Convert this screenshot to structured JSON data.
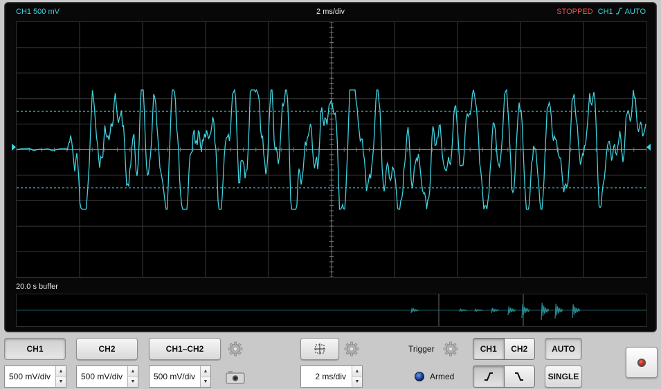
{
  "scope": {
    "ch1_scale_label": "CH1 500 mV",
    "timebase_label": "2 ms/div",
    "trigger_state": "STOPPED",
    "trigger_channel": "CH1",
    "trigger_mode": "AUTO",
    "buffer_label": "20.0 s buffer",
    "trace_color": "#3fd3e0",
    "trigger_upper_level_div": 1.5,
    "trigger_lower_level_div": -1.5,
    "grid_divisions": {
      "horizontal": 10,
      "vertical": 10
    }
  },
  "controls": {
    "ch1_button": "CH1",
    "ch2_button": "CH2",
    "diff_button": "CH1–CH2",
    "ch1_scale_value": "500 mV/div",
    "ch2_scale_value": "500 mV/div",
    "diff_scale_value": "500 mV/div",
    "timebase_value": "2 ms/div",
    "trigger_label": "Trigger",
    "armed_label": "Armed",
    "trigger_source_ch1": "CH1",
    "trigger_source_ch2": "CH2",
    "auto_button": "AUTO",
    "single_button": "SINGLE"
  },
  "icons": {
    "gear": "gear-icon",
    "camera": "camera-icon",
    "crosshair": "crosshair-icon",
    "rising_edge": "rising-edge-icon",
    "falling_edge": "falling-edge-icon",
    "record": "record-icon"
  }
}
